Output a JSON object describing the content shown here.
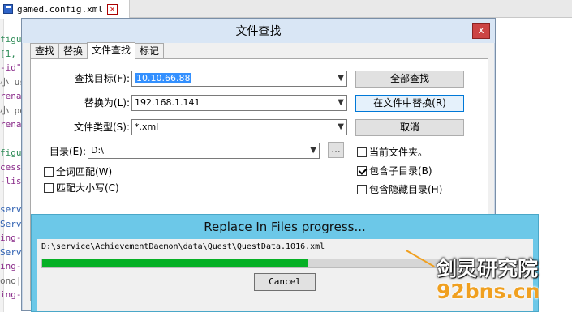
{
  "editor": {
    "tab_label": "gamed.config.xml",
    "code_lines": [
      {
        "text": "figu",
        "color": "green"
      },
      {
        "text": " [1,",
        "color": "green"
      },
      {
        "text": "-id\"",
        "color": "purple"
      },
      {
        "text": "小 us",
        "color": "gray"
      },
      {
        "text": "rena",
        "color": "purple"
      },
      {
        "text": "小 po",
        "color": "gray"
      },
      {
        "text": "rena",
        "color": "purple"
      },
      {
        "text": "",
        "color": "gray"
      },
      {
        "text": "figu",
        "color": "green"
      },
      {
        "text": "cess",
        "color": "purple"
      },
      {
        "text": "-lis",
        "color": "purple"
      },
      {
        "text": "",
        "color": "gray"
      },
      {
        "text": "serv",
        "color": "blue"
      },
      {
        "text": "Serv",
        "color": "blue"
      },
      {
        "text": "ing-",
        "color": "purple"
      },
      {
        "text": "Serv",
        "color": "blue"
      },
      {
        "text": "ing-",
        "color": "purple"
      },
      {
        "text": "ono|",
        "color": "gray"
      },
      {
        "text": "ing-",
        "color": "purple"
      }
    ]
  },
  "find_dialog": {
    "title": "文件查找",
    "close_glyph": "x",
    "tabs": [
      "查找",
      "替换",
      "文件查找",
      "标记"
    ],
    "active_tab": 2,
    "find_label": "查找目标(F):",
    "find_value": "10.10.66.88",
    "replace_label": "替换为(L):",
    "replace_value": "192.168.1.141",
    "filetype_label": "文件类型(S):",
    "filetype_value": "*.xml",
    "dir_label": "目录(E):",
    "dir_value": "D:\\",
    "browse_label": "...",
    "btn_find_all": "全部查找",
    "btn_replace_in_files": "在文件中替换(R)",
    "btn_cancel": "取消",
    "opt_whole_word": {
      "label": "全词匹配(W)",
      "checked": false
    },
    "opt_match_case": {
      "label": "匹配大小写(C)",
      "checked": false
    },
    "opt_current_folder": {
      "label": "当前文件夹。",
      "checked": false
    },
    "opt_subfolders": {
      "label": "包含子目录(B)",
      "checked": true
    },
    "opt_hidden": {
      "label": "包含隐藏目录(H)",
      "checked": false
    }
  },
  "progress_dialog": {
    "title": "Replace In Files progress...",
    "current_file": "D:\\service\\AchievementDaemon\\data\\Quest\\QuestData.1016.xml",
    "progress_percent": 55,
    "cancel_label": "Cancel"
  },
  "watermark": {
    "line1": "剑灵研究院",
    "line2": "92bns.cn"
  },
  "colors": {
    "progress_fill": "#06b025",
    "progress_titlebar": "#6cc8e8",
    "dialog_titlebar": "#d9e6f5",
    "close_button": "#cc4444"
  }
}
